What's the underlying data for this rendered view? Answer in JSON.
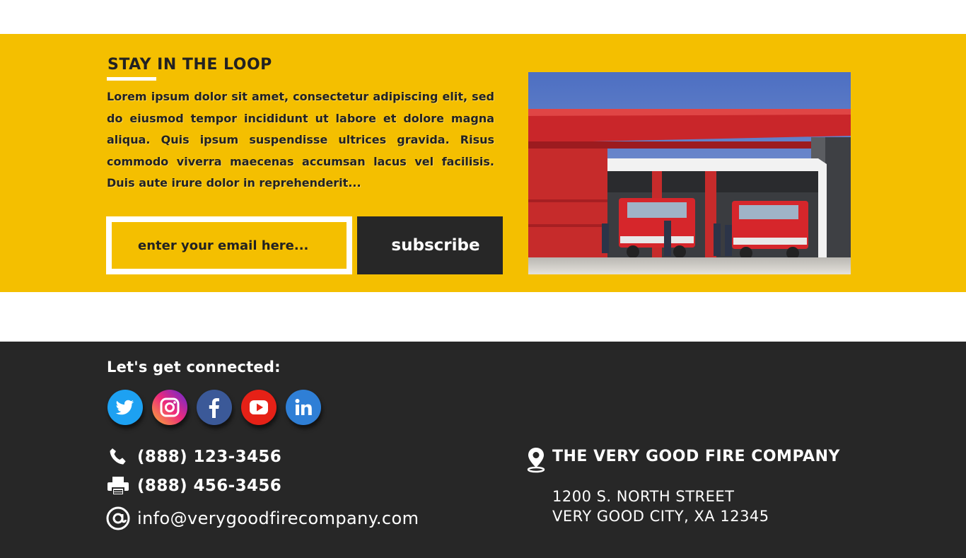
{
  "newsletter": {
    "title": "STAY IN THE LOOP",
    "body": "Lorem ipsum dolor sit amet, consectetur adipiscing elit, sed do eiusmod tempor incididunt ut labore et dolore magna aliqua. Quis ipsum suspendisse ultrices gravida. Risus commodo viverra maecenas accumsan lacus vel facilisis. Duis aute irure dolor in reprehenderit...",
    "email_placeholder": "enter your email here...",
    "email_value": "",
    "subscribe_label": "subscribe",
    "image_icon": "fire-station-photo"
  },
  "footer": {
    "connect_title": "Let's get connected:",
    "social": [
      {
        "icon": "twitter-icon"
      },
      {
        "icon": "instagram-icon"
      },
      {
        "icon": "facebook-icon"
      },
      {
        "icon": "youtube-icon"
      },
      {
        "icon": "linkedin-icon"
      }
    ],
    "phone": "(888) 123-3456",
    "fax": "(888) 456-3456",
    "email": "info@verygoodfirecompany.com",
    "company_name": "THE VERY GOOD FIRE COMPANY",
    "address_line1": "1200 S. NORTH STREET",
    "address_line2": "VERY GOOD CITY, XA 12345"
  },
  "colors": {
    "accent_yellow": "#f4bf00",
    "dark": "#272727",
    "white": "#ffffff"
  }
}
